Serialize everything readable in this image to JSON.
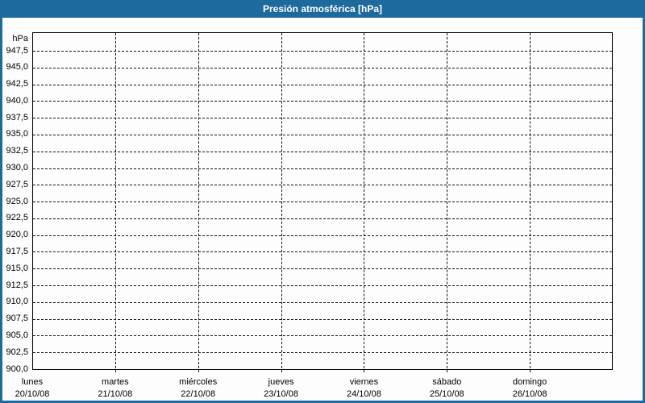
{
  "window": {
    "title": "Presión atmosférica [hPa]"
  },
  "colors": {
    "accent": "#1d6a9e",
    "title_text": "#ffffff",
    "plot_border": "#000000",
    "grid": "#111111",
    "label_text": "#000000",
    "background": "#fdfdfd"
  },
  "y_axis": {
    "unit": "hPa"
  },
  "chart_data": {
    "type": "line",
    "title": "Presión atmosférica [hPa]",
    "ylabel": "hPa",
    "ylim": [
      900,
      950
    ],
    "ytick_step": 2.5,
    "ytick_labels": [
      "947,5",
      "945,0",
      "942,5",
      "940,0",
      "937,5",
      "935,0",
      "932,5",
      "930,0",
      "927,5",
      "925,0",
      "922,5",
      "920,0",
      "917,5",
      "915,0",
      "912,5",
      "910,0",
      "907,5",
      "905,0",
      "902,5",
      "900,0"
    ],
    "x_days": [
      {
        "day": "lunes",
        "date": "20/10/08"
      },
      {
        "day": "martes",
        "date": "21/10/08"
      },
      {
        "day": "miércoles",
        "date": "22/10/08"
      },
      {
        "day": "jueves",
        "date": "23/10/08"
      },
      {
        "day": "viernes",
        "date": "24/10/08"
      },
      {
        "day": "sábado",
        "date": "25/10/08"
      },
      {
        "day": "domingo",
        "date": "26/10/08"
      }
    ],
    "grid": "dashed",
    "legend": "none",
    "series": []
  }
}
